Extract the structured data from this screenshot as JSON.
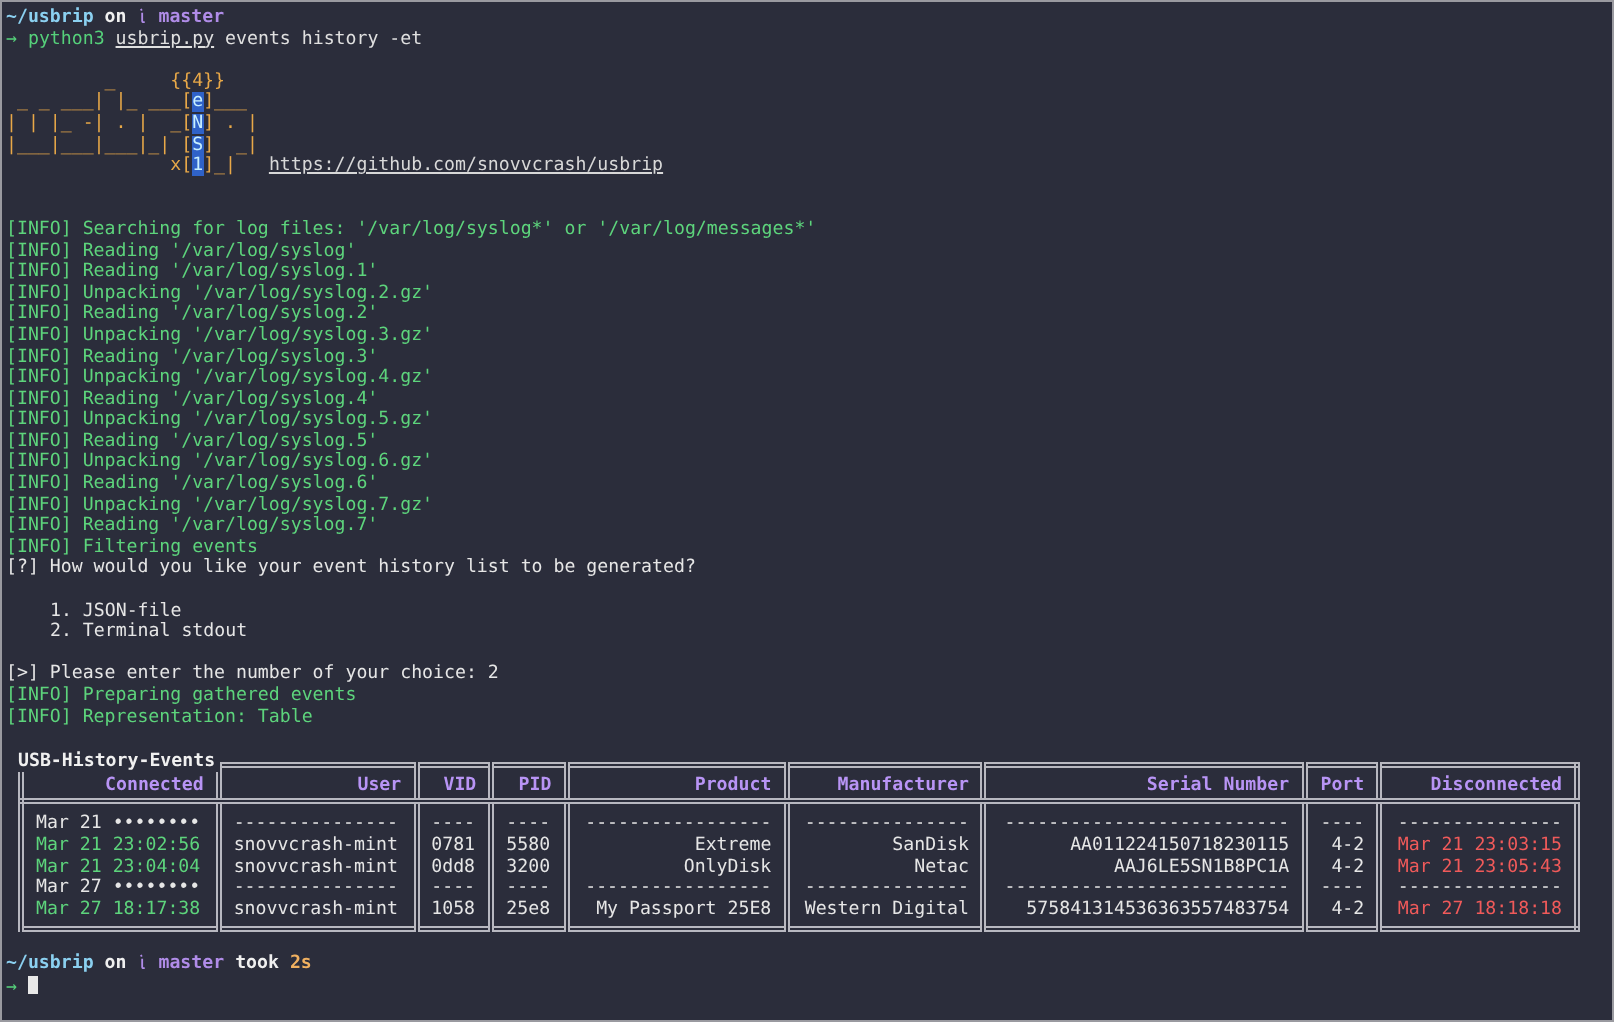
{
  "prompt": {
    "directory": "~/usbrip",
    "on": "on",
    "branch": "master"
  },
  "command": {
    "arrow": "→",
    "program": "python3",
    "script": "usbrip.py",
    "args": "events history -et"
  },
  "banner": {
    "rows": [
      [
        {
          "kind": "art",
          "text": "         _     {{4}}"
        }
      ],
      [
        {
          "kind": "art",
          "text": " _ _ ___| |_ ___["
        },
        {
          "kind": "letter",
          "text": "e"
        },
        {
          "kind": "art",
          "text": "]___"
        }
      ],
      [
        {
          "kind": "art",
          "text": "| | |_ -| . |  _["
        },
        {
          "kind": "letter",
          "text": "N"
        },
        {
          "kind": "art",
          "text": "] . |"
        }
      ],
      [
        {
          "kind": "art",
          "text": "|___|___|___|_| ["
        },
        {
          "kind": "letter",
          "text": "S"
        },
        {
          "kind": "art",
          "text": "]  _|"
        }
      ],
      [
        {
          "kind": "art",
          "text": "               x["
        },
        {
          "kind": "letter",
          "text": "1"
        },
        {
          "kind": "art",
          "text": "]_|"
        },
        {
          "kind": "link",
          "text": "https://github.com/snovvcrash/usbrip"
        }
      ]
    ]
  },
  "log_lines": [
    "[INFO] Searching for log files: '/var/log/syslog*' or '/var/log/messages*'",
    "[INFO] Reading '/var/log/syslog'",
    "[INFO] Reading '/var/log/syslog.1'",
    "[INFO] Unpacking '/var/log/syslog.2.gz'",
    "[INFO] Reading '/var/log/syslog.2'",
    "[INFO] Unpacking '/var/log/syslog.3.gz'",
    "[INFO] Reading '/var/log/syslog.3'",
    "[INFO] Unpacking '/var/log/syslog.4.gz'",
    "[INFO] Reading '/var/log/syslog.4'",
    "[INFO] Unpacking '/var/log/syslog.5.gz'",
    "[INFO] Reading '/var/log/syslog.5'",
    "[INFO] Unpacking '/var/log/syslog.6.gz'",
    "[INFO] Reading '/var/log/syslog.6'",
    "[INFO] Unpacking '/var/log/syslog.7.gz'",
    "[INFO] Reading '/var/log/syslog.7'",
    "[INFO] Filtering events"
  ],
  "question": "[?] How would you like your event history list to be generated?",
  "options": [
    "1. JSON-file",
    "2. Terminal stdout"
  ],
  "choice_prompt": "[>] Please enter the number of your choice: 2",
  "result_lines": [
    "[INFO] Preparing gathered events",
    "[INFO] Representation: Table"
  ],
  "table": {
    "title": "USB-History-Events",
    "columns": [
      "Connected",
      "User",
      "VID",
      "PID",
      "Product",
      "Manufacturer",
      "Serial Number",
      "Port",
      "Disconnected"
    ],
    "rows": [
      {
        "kind": "date",
        "cells": [
          "Mar 21 ••••••••",
          "---------------",
          "----",
          "----",
          "-----------------",
          "---------------",
          "--------------------------",
          "----",
          "---------------"
        ]
      },
      {
        "kind": "event",
        "cells": [
          "Mar 21 23:02:56",
          "snovvcrash-mint",
          "0781",
          "5580",
          "Extreme",
          "SanDisk",
          "AA011224150718230115",
          "4-2",
          "Mar 21 23:03:15"
        ]
      },
      {
        "kind": "event",
        "cells": [
          "Mar 21 23:04:04",
          "snovvcrash-mint",
          "0dd8",
          "3200",
          "OnlyDisk",
          "Netac",
          "AAJ6LE5SN1B8PC1A",
          "4-2",
          "Mar 21 23:05:43"
        ]
      },
      {
        "kind": "date",
        "cells": [
          "Mar 27 ••••••••",
          "---------------",
          "----",
          "----",
          "-----------------",
          "---------------",
          "--------------------------",
          "----",
          "---------------"
        ]
      },
      {
        "kind": "event",
        "cells": [
          "Mar 27 18:17:38",
          "snovvcrash-mint",
          "1058",
          "25e8",
          "My Passport 25E8",
          "Western Digital",
          "575841314536363557483754",
          "4-2",
          "Mar 27 18:18:18"
        ]
      }
    ]
  },
  "final_prompt": {
    "directory": "~/usbrip",
    "on": "on",
    "branch": "master",
    "took": "took",
    "duration": "2s",
    "arrow": "→"
  }
}
